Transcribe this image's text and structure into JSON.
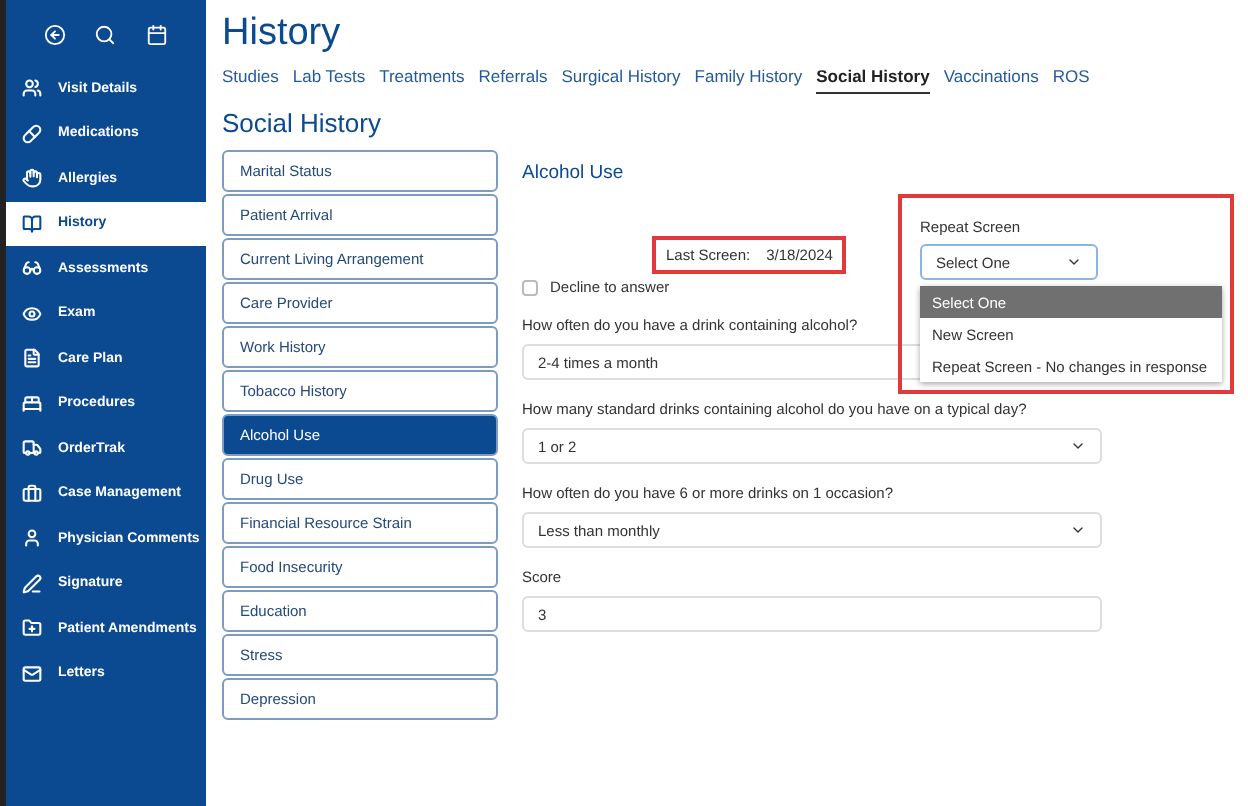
{
  "sidebar": {
    "toolbar": [
      {
        "kind": "back"
      },
      {
        "kind": "search"
      },
      {
        "kind": "calendar"
      }
    ],
    "items": [
      {
        "label": "Visit Details",
        "kind": "users",
        "selected": false
      },
      {
        "label": "Medications",
        "kind": "pill",
        "selected": false
      },
      {
        "label": "Allergies",
        "kind": "hand",
        "selected": false
      },
      {
        "label": "History",
        "kind": "book",
        "selected": true
      },
      {
        "label": "Assessments",
        "kind": "glasses",
        "selected": false
      },
      {
        "label": "Exam",
        "kind": "eye",
        "selected": false
      },
      {
        "label": "Care Plan",
        "kind": "file",
        "selected": false
      },
      {
        "label": "Procedures",
        "kind": "bed",
        "selected": false
      },
      {
        "label": "OrderTrak",
        "kind": "truck",
        "selected": false
      },
      {
        "label": "Case Management",
        "kind": "briefcase",
        "selected": false
      },
      {
        "label": "Physician Comments",
        "kind": "user",
        "selected": false
      },
      {
        "label": "Signature",
        "kind": "pen",
        "selected": false
      },
      {
        "label": "Patient Amendments",
        "kind": "folder",
        "selected": false
      },
      {
        "label": "Letters",
        "kind": "mail",
        "selected": false
      }
    ]
  },
  "page_title": "History",
  "tabs": [
    {
      "label": "Studies",
      "selected": false
    },
    {
      "label": "Lab Tests",
      "selected": false
    },
    {
      "label": "Treatments",
      "selected": false
    },
    {
      "label": "Referrals",
      "selected": false
    },
    {
      "label": "Surgical History",
      "selected": false
    },
    {
      "label": "Family History",
      "selected": false
    },
    {
      "label": "Social History",
      "selected": true
    },
    {
      "label": "Vaccinations",
      "selected": false
    },
    {
      "label": "ROS",
      "selected": false
    }
  ],
  "section_title": "Social History",
  "sections": [
    {
      "label": "Marital Status",
      "selected": false
    },
    {
      "label": "Patient Arrival",
      "selected": false
    },
    {
      "label": "Current Living Arrangement",
      "selected": false
    },
    {
      "label": "Care Provider",
      "selected": false
    },
    {
      "label": "Work History",
      "selected": false
    },
    {
      "label": "Tobacco History",
      "selected": false
    },
    {
      "label": "Alcohol Use",
      "selected": true
    },
    {
      "label": "Drug Use",
      "selected": false
    },
    {
      "label": "Financial Resource Strain",
      "selected": false
    },
    {
      "label": "Food Insecurity",
      "selected": false
    },
    {
      "label": "Education",
      "selected": false
    },
    {
      "label": "Stress",
      "selected": false
    },
    {
      "label": "Depression",
      "selected": false
    }
  ],
  "form": {
    "title": "Alcohol Use",
    "last_screen": {
      "label": "Last Screen:",
      "value": "3/18/2024"
    },
    "decline": {
      "label": "Decline to answer",
      "checked": false
    },
    "fields": [
      {
        "kind": "covered-select",
        "label": "How often do you have a drink containing alcohol?",
        "value": "2-4 times a month"
      },
      {
        "kind": "select",
        "label": "How many standard drinks containing alcohol do you have on a typical day?",
        "value": "1 or 2"
      },
      {
        "kind": "select",
        "label": "How often do you have 6 or more drinks on 1 occasion?",
        "value": "Less than monthly"
      },
      {
        "kind": "text",
        "label": "Score",
        "value": "3"
      }
    ]
  },
  "repeat_screen": {
    "label": "Repeat Screen",
    "value": "Select One",
    "options": [
      {
        "label": "Select One",
        "selected": true
      },
      {
        "label": "New Screen",
        "selected": false
      },
      {
        "label": "Repeat Screen - No changes in response",
        "selected": false
      }
    ]
  }
}
